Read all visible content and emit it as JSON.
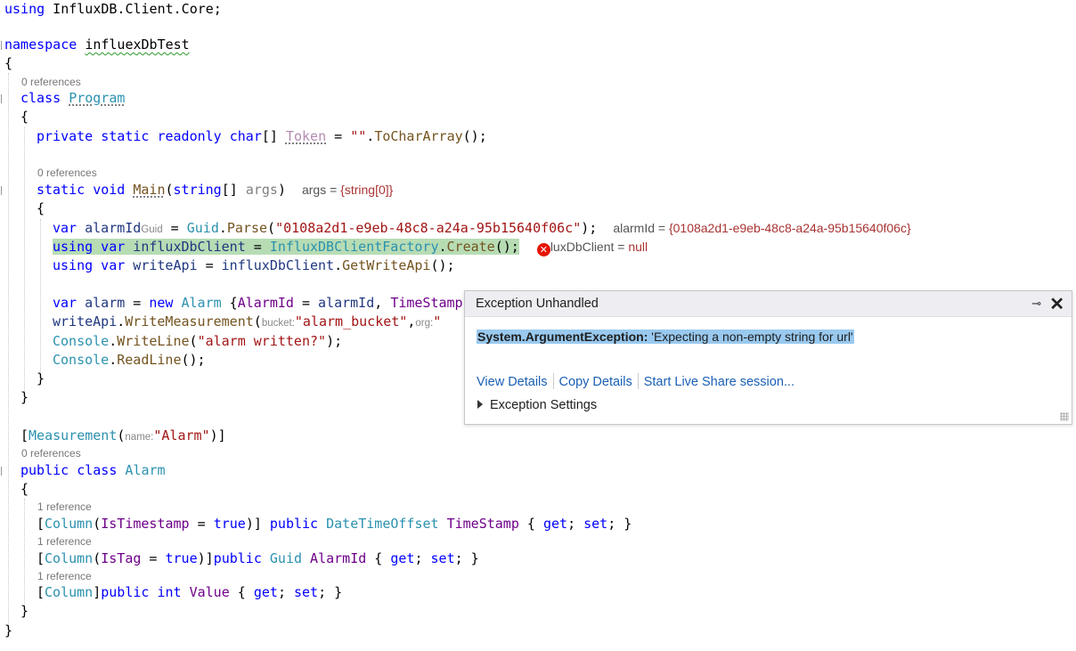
{
  "editor": {
    "line_using": {
      "kw": "using",
      "ns": " InfluxDB.Client.Core;"
    },
    "line_namespace": {
      "kw": "namespace",
      "name": "influexDbTest"
    },
    "brace_open": "{",
    "brace_close": "}",
    "refs_0": "0 references",
    "refs_1": "1 reference",
    "class_program": {
      "kw": "class",
      "name": "Program"
    },
    "token_line": {
      "mods": "private static readonly",
      "type": " char",
      "rest": "[] ",
      "name": "Token",
      "assign": " = ",
      "str": "\"\"",
      "dot": ".",
      "method": "ToCharArray",
      "end": "();"
    },
    "main_line": {
      "mods": "static void",
      "name": "Main",
      "open": "(",
      "type": "string",
      "arr": "[] ",
      "param": "args",
      "close": ")"
    },
    "main_tip": {
      "label": "args = ",
      "value": "{string[0]}"
    },
    "alarmid_line": {
      "kw": "var",
      "name": " alarmId",
      "hint": "Guid",
      "eq": " = ",
      "type": "Guid",
      "dot": ".",
      "method": "Parse",
      "open": "(",
      "str": "\"0108a2d1-e9eb-48c8-a24a-95b15640f06c\"",
      "end": ");"
    },
    "alarmid_tip": {
      "label": "alarmId = ",
      "value": "{0108a2d1-e9eb-48c8-a24a-95b15640f06c}"
    },
    "client_line": {
      "kw": "using var",
      "name": " influxDbClient",
      "eq": " = ",
      "type": "InfluxDBClientFactory",
      "dot": ".",
      "method": "Create",
      "end": "();"
    },
    "client_tip": {
      "label": "luxDbClient = ",
      "value": "null"
    },
    "writeapi_line": {
      "kw": "using var",
      "name": " writeApi",
      "eq": " = ",
      "obj": "influxDbClient",
      "dot": ".",
      "method": "GetWriteApi",
      "end": "();"
    },
    "alarm_line": {
      "kw": "var",
      "name": " alarm",
      "eq": " = ",
      "new": "new",
      "type": " Alarm",
      "rest": " {",
      "prop": "AlarmId",
      "eq2": " = ",
      "val": "alarmId",
      "comma": ", ",
      "prop2": "TimeStamp"
    },
    "write_line": {
      "obj": "writeApi",
      "dot": ".",
      "method": "WriteMeasurement",
      "open": "(",
      "hint1": "bucket:",
      "str": "\"alarm_bucket\"",
      "comma": ",",
      "hint2": "org:",
      "str2": "\""
    },
    "console1": {
      "type": "Console",
      "dot": ".",
      "method": "WriteLine",
      "open": "(",
      "str": "\"alarm written?\"",
      "end": ");"
    },
    "console2": {
      "type": "Console",
      "dot": ".",
      "method": "ReadLine",
      "end": "();"
    },
    "measurement_line": {
      "open": "[",
      "type": "Measurement",
      "paren": "(",
      "hint": "name:",
      "str": "\"Alarm\"",
      "end": ")]"
    },
    "class_alarm": {
      "kw": "public class",
      "name": " Alarm"
    },
    "prop_ts": {
      "open": "[",
      "type": "Column",
      "paren": "(",
      "arg": "IsTimestamp",
      "eq": " = ",
      "kw": "true",
      "close": ")] ",
      "mods": "public",
      "ptype": " DateTimeOffset",
      "name": " TimeStamp",
      "acc": " { ",
      "get": "get",
      "semi": "; ",
      "set": "set",
      "end": "; }"
    },
    "prop_tag": {
      "open": "[",
      "type": "Column",
      "paren": "(",
      "arg": "IsTag",
      "eq": " = ",
      "kw": "true",
      "close": ")]",
      "mods": "public",
      "ptype": " Guid",
      "name": " AlarmId",
      "acc": " { ",
      "get": "get",
      "semi": "; ",
      "set": "set",
      "end": "; }"
    },
    "prop_val": {
      "open": "[",
      "type": "Column",
      "close": "]",
      "mods": "public int",
      "name": " Value",
      "acc": " { ",
      "get": "get",
      "semi": "; ",
      "set": "set",
      "end": "; }"
    }
  },
  "popup": {
    "title": "Exception Unhandled",
    "pin_icon": "pin-icon",
    "close_icon": "close-icon",
    "exception_type": "System.ArgumentException:",
    "exception_message": " 'Expecting a non-empty string for url'",
    "link_view": "View Details",
    "link_copy": "Copy Details",
    "link_share": "Start Live Share session...",
    "settings": "Exception Settings"
  },
  "colors": {
    "error": "#e51400",
    "highlight": "#b7dcb4",
    "link": "#1a5fb4",
    "selection": "#99c9ef"
  }
}
